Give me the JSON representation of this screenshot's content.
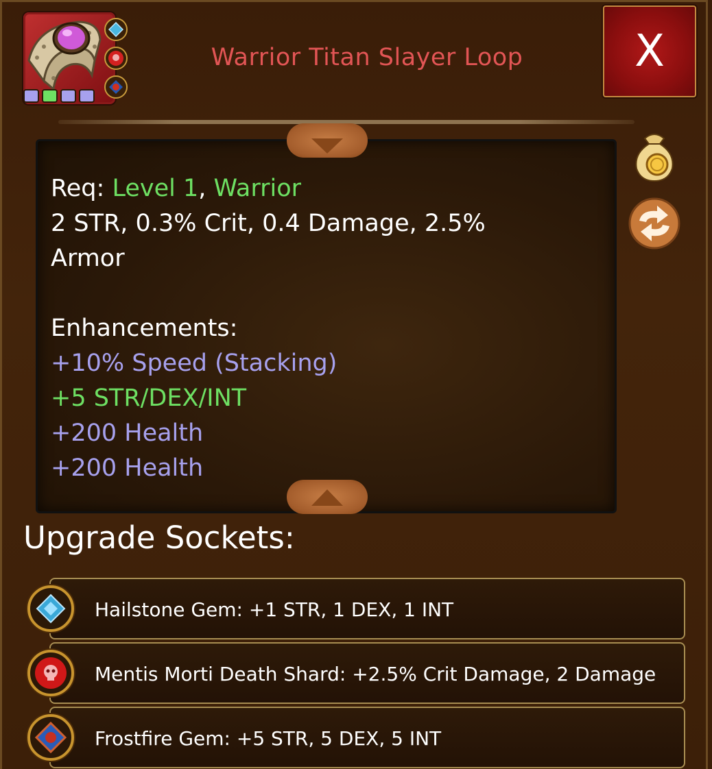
{
  "item": {
    "title": "Warrior Titan Slayer Loop",
    "title_color": "#e25555",
    "icon": "gold-ring-with-pink-gem-icon",
    "quality_dots": [
      "#a7a1ee",
      "#6ee063",
      "#a7a1ee",
      "#a7a1ee"
    ],
    "socket_icons": [
      "hailstone-gem-icon",
      "death-shard-skull-icon",
      "frostfire-gem-icon"
    ]
  },
  "close_button": {
    "label": "X"
  },
  "description": {
    "req_label": "Req:",
    "req_level": "Level 1",
    "req_separator": ",",
    "req_class": "Warrior",
    "stats_line1": "2 STR, 0.3% Crit, 0.4 Damage, 2.5%",
    "stats_line2": "Armor",
    "enhancements_label": "Enhancements:",
    "enhancements": [
      {
        "text": "+10% Speed (Stacking)",
        "color": "#a7a1ee"
      },
      {
        "text": "+5 STR/DEX/INT",
        "color": "#6ee063"
      },
      {
        "text": "+200 Health",
        "color": "#a7a1ee"
      },
      {
        "text": "+200 Health",
        "color": "#a7a1ee"
      }
    ]
  },
  "side_actions": {
    "sell_icon": "gold-coin-bag-icon",
    "swap_icon": "swap-arrows-icon"
  },
  "upgrade_sockets": {
    "title": "Upgrade Sockets:",
    "items": [
      {
        "text": "Hailstone Gem: +1 STR, 1 DEX, 1 INT",
        "icon": "hailstone-gem-icon"
      },
      {
        "text": "Mentis Morti Death Shard: +2.5% Crit Damage, 2 Damage",
        "icon": "death-shard-skull-icon"
      },
      {
        "text": "Frostfire Gem: +5 STR, 5 DEX, 5 INT",
        "icon": "frostfire-gem-icon"
      }
    ]
  }
}
